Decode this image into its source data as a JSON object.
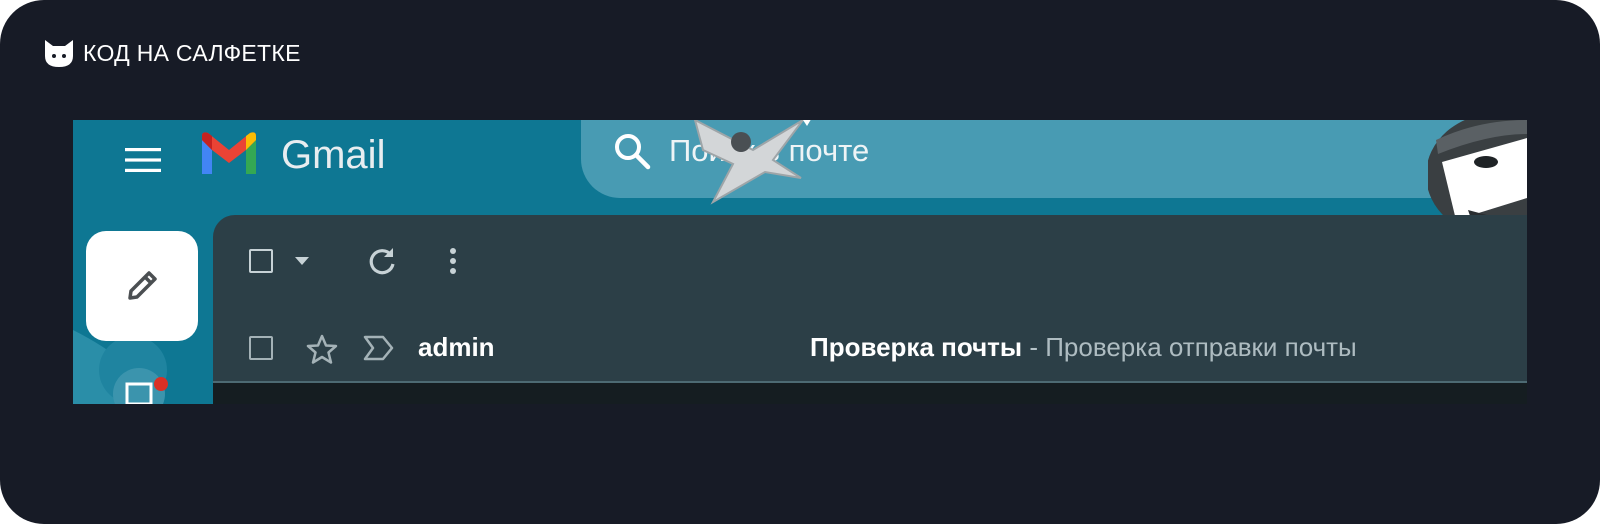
{
  "brand": {
    "name": "КОД НА САЛФЕТКЕ",
    "icon": "cat-icon"
  },
  "gmail": {
    "app_name": "Gmail",
    "search": {
      "placeholder": "Поиск в почте"
    },
    "colors": {
      "header_bg": "#0e7793",
      "panel_bg": "#2c3f47",
      "page_bg": "#171b26",
      "badge": "#d93025"
    },
    "toolbar": {
      "icons": [
        "checkbox-icon",
        "caret-down-icon",
        "refresh-icon",
        "more-vert-icon"
      ]
    },
    "messages": [
      {
        "sender": "admin",
        "subject": "Проверка почты",
        "separator": " - ",
        "snippet": "Проверка отправки почты"
      }
    ]
  }
}
